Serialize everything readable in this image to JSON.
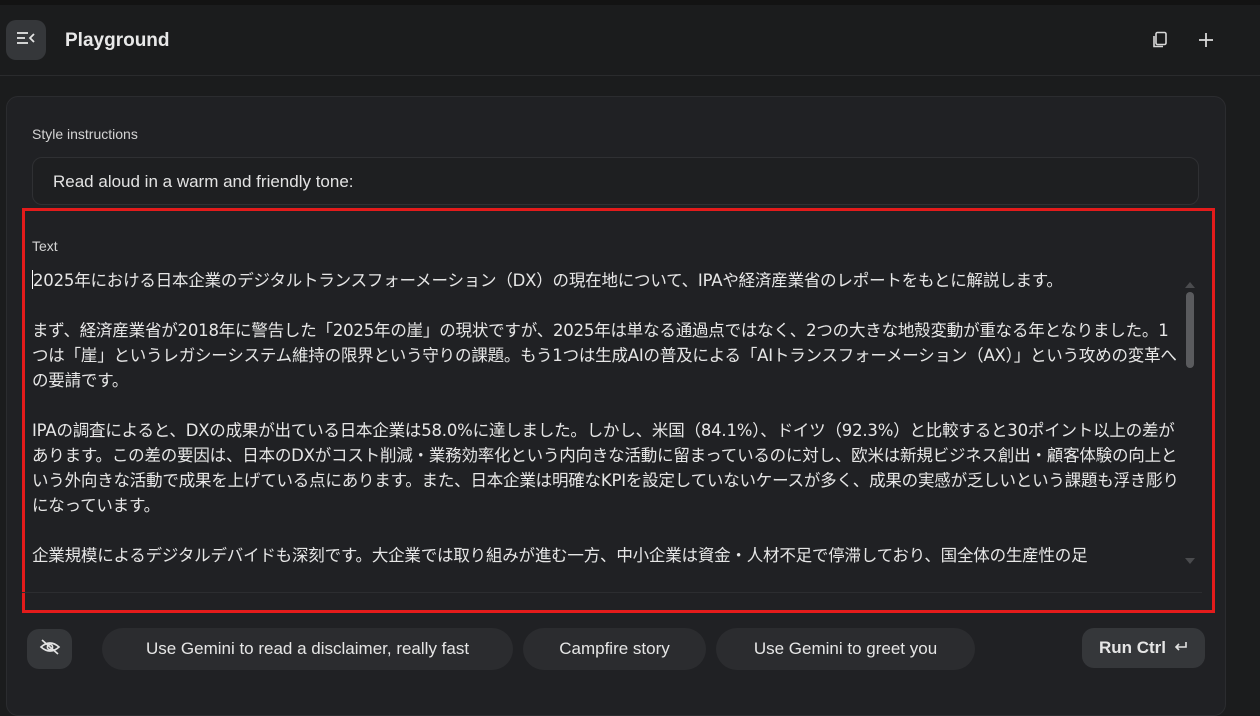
{
  "header": {
    "title": "Playground",
    "menu_icon": "sidebar-collapse-icon",
    "copy_icon": "copy-icon",
    "add_icon": "plus-icon"
  },
  "style_instructions": {
    "label": "Style instructions",
    "value": "Read aloud in a warm and friendly tone:"
  },
  "text_section": {
    "label": "Text",
    "paragraphs": [
      "2025年における日本企業のデジタルトランスフォーメーション（DX）の現在地について、IPAや経済産業省のレポートをもとに解説します。",
      "まず、経済産業省が2018年に警告した「2025年の崖」の現状ですが、2025年は単なる通過点ではなく、2つの大きな地殻変動が重なる年となりました。1つは「崖」というレガシーシステム維持の限界という守りの課題。もう1つは生成AIの普及による「AIトランスフォーメーション（AX）」という攻めの変革への要請です。",
      "IPAの調査によると、DXの成果が出ている日本企業は58.0%に達しました。しかし、米国（84.1%）、ドイツ（92.3%）と比較すると30ポイント以上の差があります。この差の要因は、日本のDXがコスト削減・業務効率化という内向きな活動に留まっているのに対し、欧米は新規ビジネス創出・顧客体験の向上という外向きな活動で成果を上げている点にあります。また、日本企業は明確なKPIを設定していないケースが多く、成果の実感が乏しいという課題も浮き彫りになっています。",
      "企業規模によるデジタルデバイドも深刻です。大企業では取り組みが進む一方、中小企業は資金・人材不足で停滞しており、国全体の生産性の足"
    ]
  },
  "bottom_bar": {
    "visibility_icon": "eye-off-icon",
    "suggestions": [
      "Use Gemini to read a disclaimer, really fast",
      "Campfire story",
      "Use Gemini to greet you"
    ],
    "run_label": "Run Ctrl",
    "run_icon": "enter-key-icon"
  },
  "colors": {
    "background": "#1b1c1d",
    "panel": "#202124",
    "highlight_border": "#e31b1b"
  }
}
